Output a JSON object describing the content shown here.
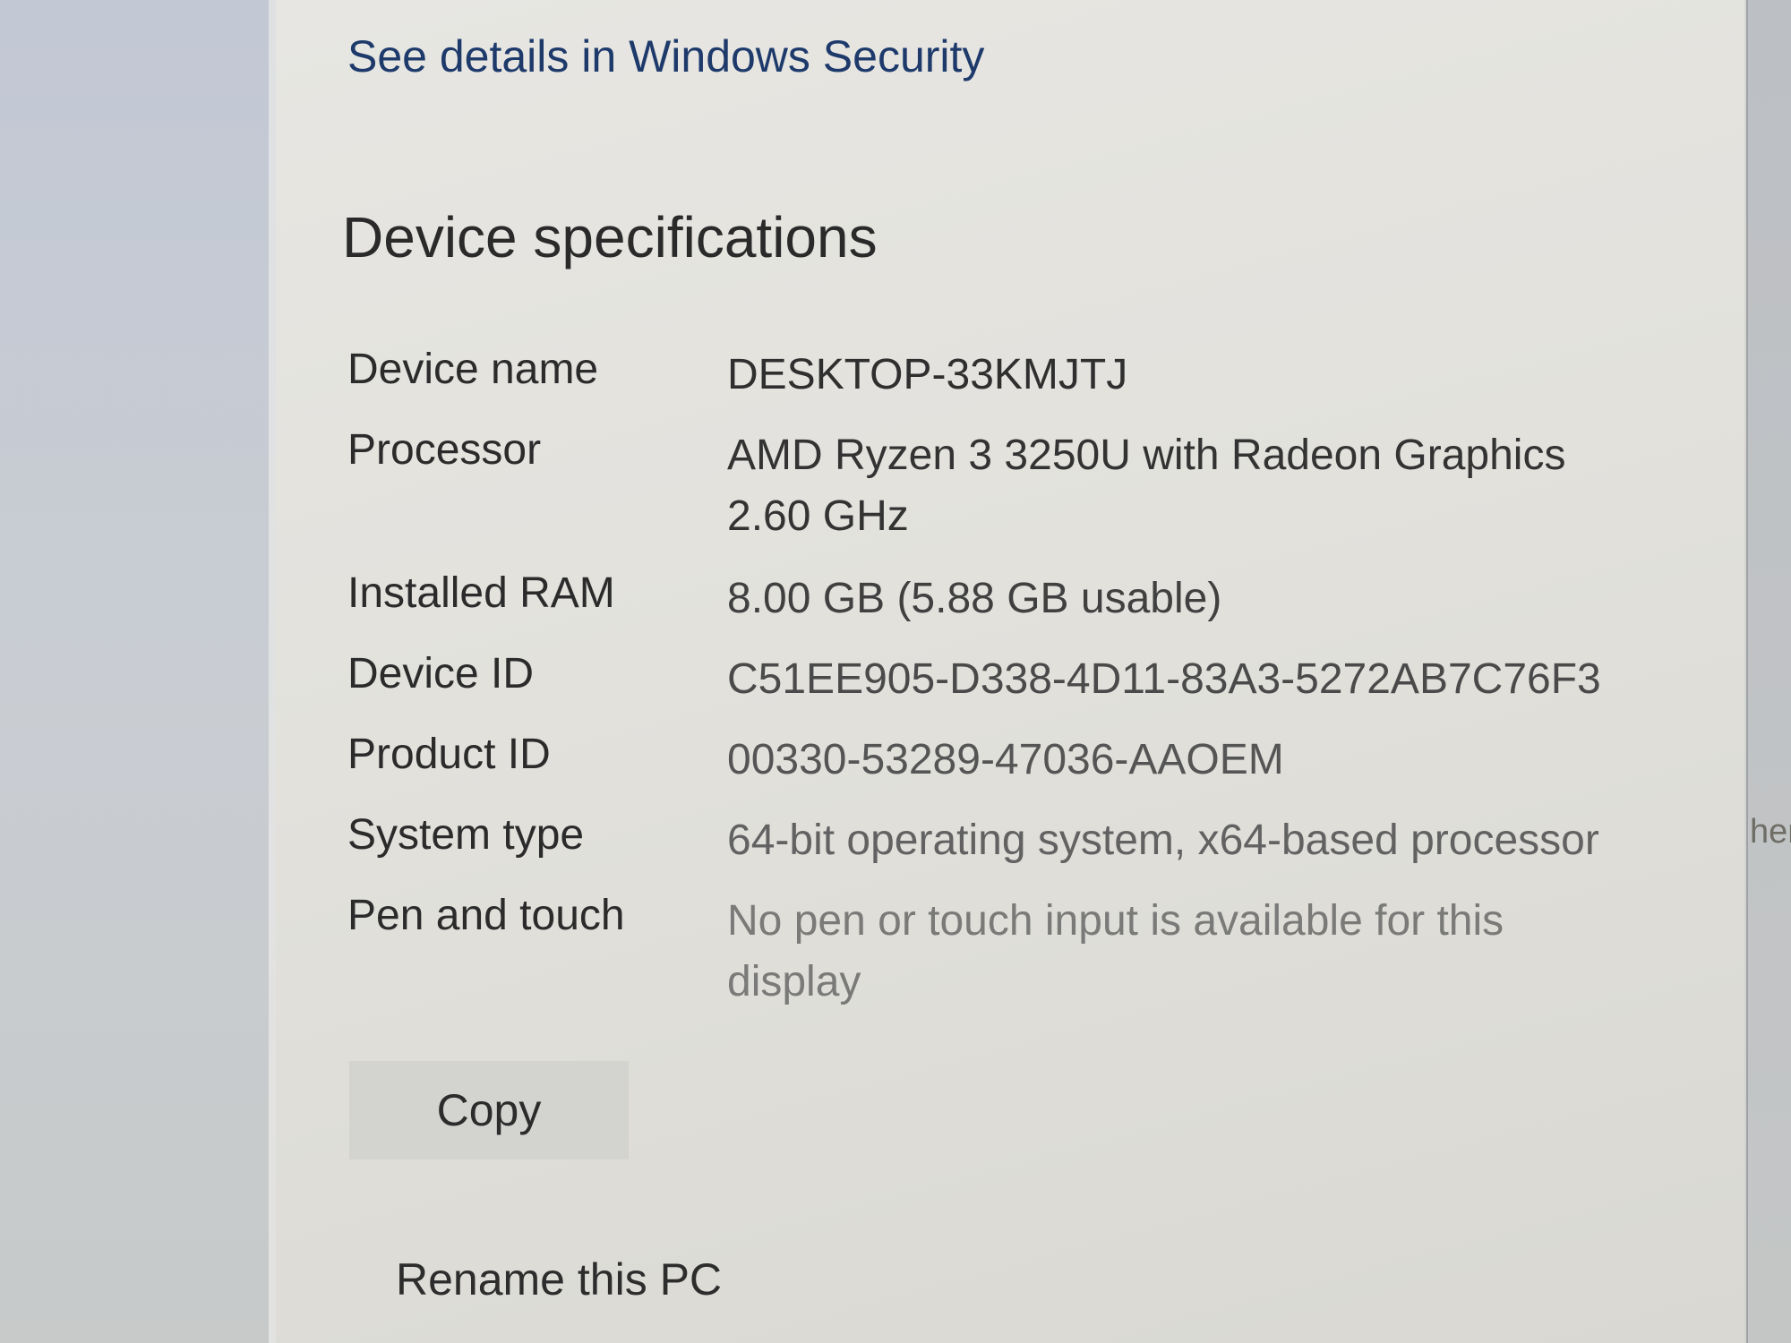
{
  "security": {
    "link_label": "See details in Windows Security"
  },
  "device_specs": {
    "title": "Device specifications",
    "rows": [
      {
        "label": "Device name",
        "value": "DESKTOP-33KMJTJ"
      },
      {
        "label": "Processor",
        "value": "AMD Ryzen 3 3250U with Radeon Graphics 2.60 GHz"
      },
      {
        "label": "Installed RAM",
        "value": "8.00 GB (5.88 GB usable)"
      },
      {
        "label": "Device ID",
        "value": "C51EE905-D338-4D11-83A3-5272AB7C76F3"
      },
      {
        "label": "Product ID",
        "value": "00330-53289-47036-AAOEM"
      },
      {
        "label": "System type",
        "value": "64-bit operating system, x64-based processor"
      },
      {
        "label": "Pen and touch",
        "value": "No pen or touch input is available for this display"
      }
    ],
    "copy_label": "Copy"
  },
  "rename": {
    "label": "Rename this PC"
  },
  "right_pane": {
    "clipped_text": "her"
  }
}
